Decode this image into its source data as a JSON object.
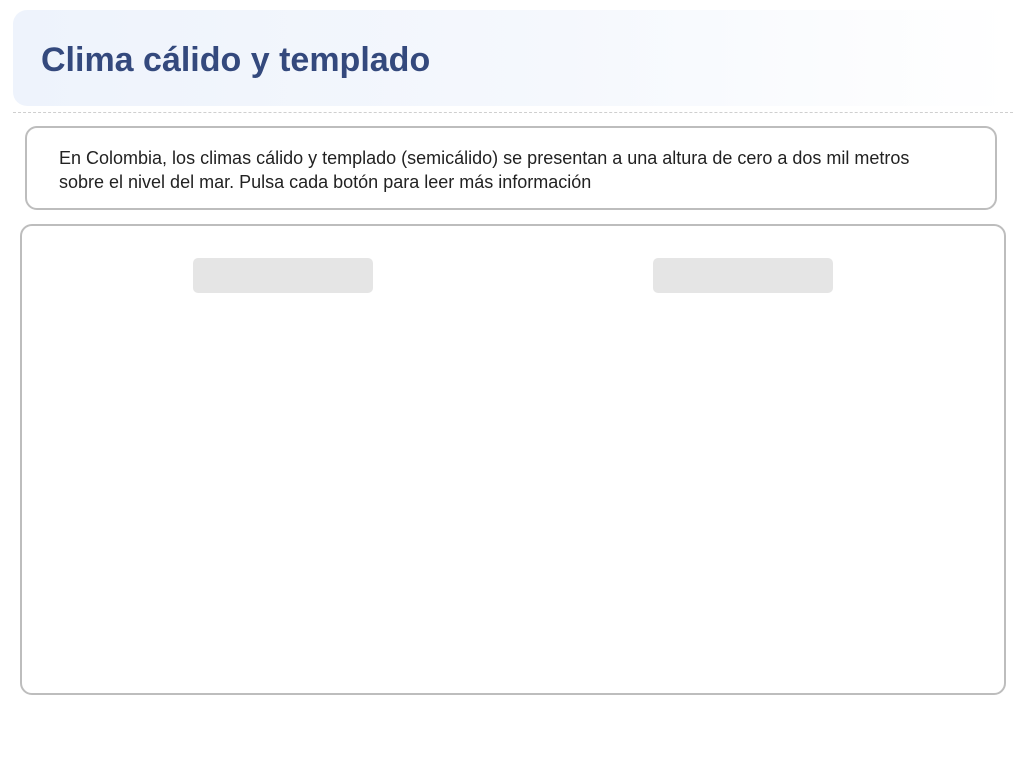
{
  "header": {
    "title": "Clima cálido y templado"
  },
  "intro": {
    "text": "En Colombia, los climas cálido y templado (semicálido) se presentan a una altura de cero a dos mil metros sobre el nivel del mar. Pulsa cada botón para leer más información"
  },
  "panel": {
    "buttons": [
      {
        "label": ""
      },
      {
        "label": ""
      }
    ]
  },
  "colors": {
    "title": "#34497d",
    "button_bg": "#e5e5e5",
    "border": "#bdbdbd"
  }
}
